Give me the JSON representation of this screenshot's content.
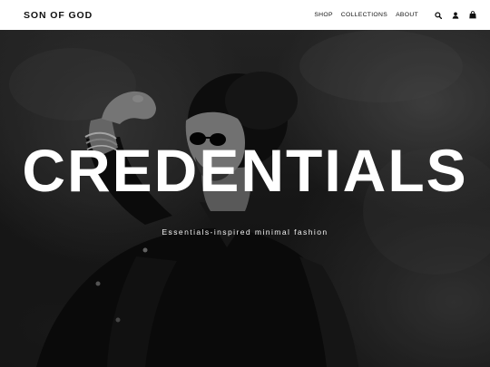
{
  "header": {
    "logo": "SON OF GOD",
    "nav": [
      {
        "label": "SHOP"
      },
      {
        "label": "COLLECTIONS"
      },
      {
        "label": "ABOUT"
      }
    ],
    "icons": [
      "search-icon",
      "account-icon",
      "cart-icon"
    ]
  },
  "hero": {
    "title": "CREDENTIALS",
    "subtitle": "Essentials-inspired minimal fashion",
    "image": "black-and-white photo of man in dark jacket with sunglasses and raised arm"
  },
  "colors": {
    "header_bg": "#ffffff",
    "text_dark": "#111111",
    "hero_text": "#ffffff"
  }
}
